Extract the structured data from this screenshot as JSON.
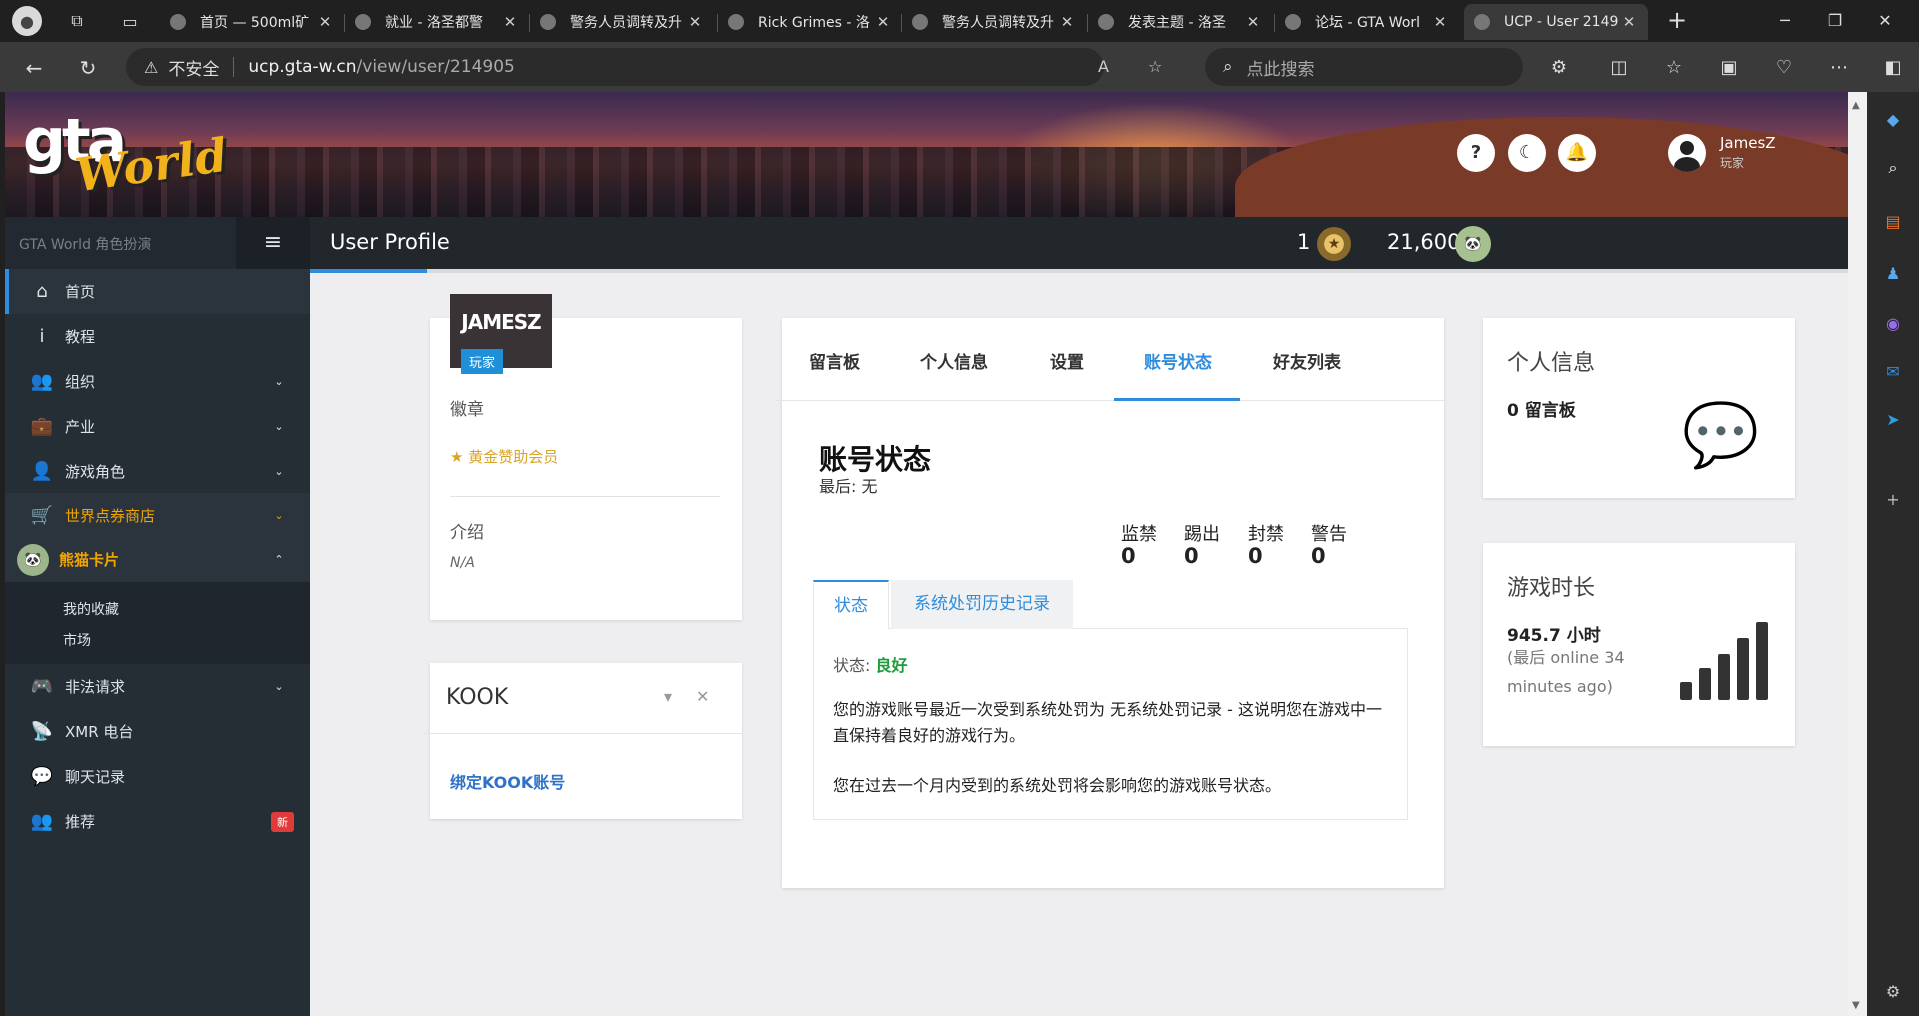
{
  "browser": {
    "tabs": [
      {
        "title": "首页 — 500ml矿",
        "active": false
      },
      {
        "title": "就业 - 洛圣都警",
        "active": false
      },
      {
        "title": "警务人员调转及升",
        "active": false
      },
      {
        "title": "Rick Grimes - 洛",
        "active": false
      },
      {
        "title": "警务人员调转及升",
        "active": false
      },
      {
        "title": "发表主题 - 洛圣",
        "active": false
      },
      {
        "title": "论坛 - GTA Worl",
        "active": false
      },
      {
        "title": "UCP - User 2149",
        "active": true
      }
    ],
    "close_glyph": "✕",
    "new_tab_glyph": "+",
    "security_label": "不安全",
    "url_host": "ucp.gta-w.cn",
    "url_path": "/view/user/214905",
    "search_placeholder": "点此搜索",
    "icons": {
      "profile": "profile-icon",
      "workspaces": "workspaces-icon",
      "tab-actions": "tab-actions-icon",
      "back": "back-arrow-icon",
      "refresh": "refresh-icon",
      "warning": "warning-icon",
      "read-aloud": "read-aloud-icon",
      "favorite": "star-icon",
      "search": "search-icon"
    }
  },
  "header": {
    "logo_gta": "gta",
    "logo_world": "World",
    "help_glyph": "?",
    "user_name": "JamesZ",
    "user_role": "玩家"
  },
  "sidebar": {
    "brand": "GTA World 角色扮演",
    "burger_glyph": "≡",
    "items": [
      {
        "label": "首页",
        "icon": "home-icon",
        "glyph": "⌂",
        "has_chevron": false,
        "style": "active"
      },
      {
        "label": "教程",
        "icon": "info-icon",
        "glyph": "i",
        "has_chevron": false,
        "style": ""
      },
      {
        "label": "组织",
        "icon": "users-icon",
        "glyph": "👥",
        "has_chevron": true,
        "style": ""
      },
      {
        "label": "产业",
        "icon": "briefcase-icon",
        "glyph": "💼",
        "has_chevron": true,
        "style": ""
      },
      {
        "label": "游戏角色",
        "icon": "user-icon",
        "glyph": "👤",
        "has_chevron": true,
        "style": ""
      },
      {
        "label": "世界点券商店",
        "icon": "cart-icon",
        "glyph": "🛒",
        "has_chevron": true,
        "style": "shop"
      },
      {
        "label": "熊猫卡片",
        "icon": "panda-icon",
        "glyph": "🐼",
        "has_chevron": true,
        "style": "panda"
      }
    ],
    "sub_items": [
      "我的收藏",
      "市场"
    ],
    "items_after": [
      {
        "label": "非法请求",
        "icon": "gamepad-icon",
        "glyph": "🎮",
        "has_chevron": true
      },
      {
        "label": "XMR 电台",
        "icon": "radio-icon",
        "glyph": "📡",
        "has_chevron": false
      },
      {
        "label": "聊天记录",
        "icon": "chat-icon",
        "glyph": "💬",
        "has_chevron": false
      },
      {
        "label": "推荐",
        "icon": "users-icon",
        "glyph": "👥",
        "has_chevron": false,
        "badge": "新"
      }
    ],
    "chevron_down": "⌄",
    "chevron_up": "⌃"
  },
  "topbar": {
    "title": "User Profile",
    "medal_count": "1",
    "coins": "21,600"
  },
  "profile_card": {
    "display_name": "JAMESZ",
    "role": "玩家",
    "badges_label": "徽章",
    "gold_member": "黄金赞助会员",
    "intro_label": "介绍",
    "intro_value": "N/A"
  },
  "kook_card": {
    "title": "KOOK",
    "bind_link": "绑定KOOK账号"
  },
  "main_tabs": [
    "留言板",
    "个人信息",
    "设置",
    "账号状态",
    "好友列表"
  ],
  "account": {
    "title": "账号状态",
    "last": "最后: 无",
    "stats": [
      {
        "label": "监禁",
        "value": "0"
      },
      {
        "label": "踢出",
        "value": "0"
      },
      {
        "label": "封禁",
        "value": "0"
      },
      {
        "label": "警告",
        "value": "0"
      }
    ],
    "sub_tabs": [
      "状态",
      "系统处罚历史记录"
    ],
    "status_label": "状态: ",
    "status_value": "良好",
    "desc1": "您的游戏账号最近一次受到系统处罚为 无系统处罚记录 - 这说明您在游戏中一直保持着良好的游戏行为。",
    "desc2": "您在过去一个月内受到的系统处罚将会影响您的游戏账号状态。"
  },
  "info_card": {
    "title": "个人信息",
    "messages": "0 留言板"
  },
  "playtime_card": {
    "title": "游戏时长",
    "hours": "945.7 小时",
    "last_online": "(最后 online 34 minutes ago)"
  },
  "colors": {
    "accent": "#2f8ddc",
    "good": "#1e9b3b",
    "gold": "#d7a52a",
    "shop": "#f0a400"
  }
}
